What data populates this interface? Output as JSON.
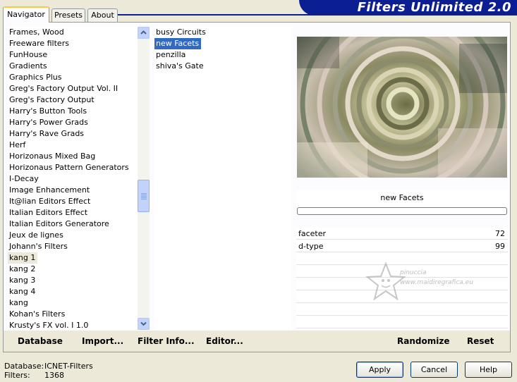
{
  "tabs": [
    {
      "label": "Navigator",
      "active": true
    },
    {
      "label": "Presets",
      "active": false
    },
    {
      "label": "About",
      "active": false
    }
  ],
  "banner": {
    "title": "Filters Unlimited 2.0"
  },
  "categories": [
    "Frames, Wood",
    "Freeware filters",
    "FunHouse",
    "Gradients",
    "Graphics Plus",
    "Greg's Factory Output Vol. II",
    "Greg's Factory Output",
    "Harry's Button Tools",
    "Harry's Power Grads",
    "Harry's Rave Grads",
    "Herf",
    "Horizonaus Mixed Bag",
    "Horizonaus Pattern Generators",
    "I-Decay",
    "Image Enhancement",
    "It@lian Editors Effect",
    "Italian Editors Effect",
    "Italian Editors Generatore",
    "Jeux de lignes",
    "Johann's Filters",
    "kang 1",
    "kang 2",
    "kang 3",
    "kang 4",
    "kang",
    "Kohan's Filters",
    "Krusty's FX vol. I 1.0"
  ],
  "selected_category": "kang 1",
  "filters": [
    "busy Circuits",
    "new Facets",
    "penzilla",
    "shiva's Gate"
  ],
  "selected_filter": "new Facets",
  "filter_title": "new Facets",
  "params": [
    {
      "name": "faceter",
      "value": "72"
    },
    {
      "name": "d-type",
      "value": "99"
    }
  ],
  "watermark": {
    "line1": "pinuccia",
    "line2": "www.maidiregrafica.eu"
  },
  "bottom_buttons": {
    "database": "Database",
    "import": "Import...",
    "filter_info": "Filter Info...",
    "editor": "Editor...",
    "randomize": "Randomize",
    "reset": "Reset"
  },
  "status": {
    "database_label": "Database:",
    "database_value": "ICNET-Filters",
    "filters_label": "Filters:",
    "filters_value": "1368"
  },
  "dialog_buttons": {
    "apply": "Apply",
    "cancel": "Cancel",
    "help": "Help"
  }
}
